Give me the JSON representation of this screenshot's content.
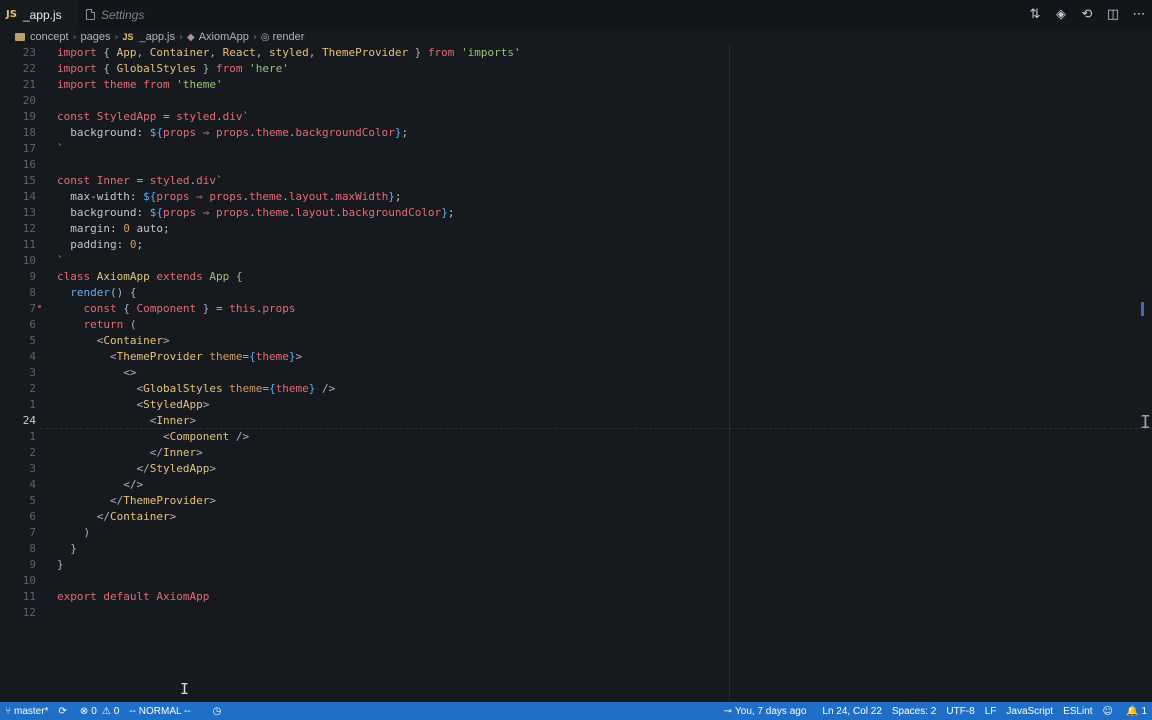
{
  "tabs": [
    {
      "label": "_app.js",
      "file_type": "JS",
      "active": true
    },
    {
      "label": "Settings",
      "active": false
    }
  ],
  "tab_actions": [
    "git-compare-icon",
    "go-to-file-icon",
    "preview-icon",
    "split-editor-icon",
    "more-actions-icon"
  ],
  "breadcrumb": {
    "items": [
      "concept",
      "pages",
      "_app.js",
      "AxiomApp",
      "render"
    ],
    "file_type": "JS"
  },
  "editor": {
    "cursor_line_index": 23,
    "lines": [
      {
        "ln": "23",
        "tokens": [
          [
            "kw",
            "import "
          ],
          [
            "punc",
            "{ "
          ],
          [
            "ty",
            "App"
          ],
          [
            "punc",
            ", "
          ],
          [
            "ty",
            "Container"
          ],
          [
            "punc",
            ", "
          ],
          [
            "ty",
            "React"
          ],
          [
            "punc",
            ", "
          ],
          [
            "ty",
            "styled"
          ],
          [
            "punc",
            ", "
          ],
          [
            "ty",
            "ThemeProvider"
          ],
          [
            "punc",
            " } "
          ],
          [
            "kw",
            "from "
          ],
          [
            "str",
            "'imports'"
          ]
        ]
      },
      {
        "ln": "22",
        "tokens": [
          [
            "kw",
            "import "
          ],
          [
            "punc",
            "{ "
          ],
          [
            "ty",
            "GlobalStyles"
          ],
          [
            "punc",
            " } "
          ],
          [
            "kw",
            "from "
          ],
          [
            "str",
            "'here'"
          ]
        ]
      },
      {
        "ln": "21",
        "tokens": [
          [
            "kw",
            "import "
          ],
          [
            "var",
            "theme "
          ],
          [
            "kw",
            "from "
          ],
          [
            "str",
            "'theme'"
          ]
        ]
      },
      {
        "ln": "20",
        "tokens": []
      },
      {
        "ln": "19",
        "tokens": [
          [
            "kw",
            "const "
          ],
          [
            "var",
            "StyledApp "
          ],
          [
            "punc",
            "= "
          ],
          [
            "var",
            "styled"
          ],
          [
            "punc",
            "."
          ],
          [
            "var",
            "div"
          ],
          [
            "str",
            "`"
          ]
        ]
      },
      {
        "ln": "18",
        "tokens": [
          [
            "txt",
            "  background: "
          ],
          [
            "fn",
            "${"
          ],
          [
            "var",
            "props "
          ],
          [
            "kw",
            "⇒ "
          ],
          [
            "var",
            "props"
          ],
          [
            "punc",
            "."
          ],
          [
            "var",
            "theme"
          ],
          [
            "punc",
            "."
          ],
          [
            "var",
            "backgroundColor"
          ],
          [
            "fn",
            "}"
          ],
          [
            "txt",
            ";"
          ]
        ]
      },
      {
        "ln": "17",
        "tokens": [
          [
            "str",
            "`"
          ]
        ]
      },
      {
        "ln": "16",
        "tokens": []
      },
      {
        "ln": "15",
        "tokens": [
          [
            "kw",
            "const "
          ],
          [
            "var",
            "Inner "
          ],
          [
            "punc",
            "= "
          ],
          [
            "var",
            "styled"
          ],
          [
            "punc",
            "."
          ],
          [
            "var",
            "div"
          ],
          [
            "str",
            "`"
          ]
        ]
      },
      {
        "ln": "14",
        "tokens": [
          [
            "txt",
            "  max-width: "
          ],
          [
            "fn",
            "${"
          ],
          [
            "var",
            "props "
          ],
          [
            "kw",
            "⇒ "
          ],
          [
            "var",
            "props"
          ],
          [
            "punc",
            "."
          ],
          [
            "var",
            "theme"
          ],
          [
            "punc",
            "."
          ],
          [
            "var",
            "layout"
          ],
          [
            "punc",
            "."
          ],
          [
            "var",
            "maxWidth"
          ],
          [
            "fn",
            "}"
          ],
          [
            "txt",
            ";"
          ]
        ]
      },
      {
        "ln": "13",
        "tokens": [
          [
            "txt",
            "  background: "
          ],
          [
            "fn",
            "${"
          ],
          [
            "var",
            "props "
          ],
          [
            "kw",
            "⇒ "
          ],
          [
            "var",
            "props"
          ],
          [
            "punc",
            "."
          ],
          [
            "var",
            "theme"
          ],
          [
            "punc",
            "."
          ],
          [
            "var",
            "layout"
          ],
          [
            "punc",
            "."
          ],
          [
            "var",
            "backgroundColor"
          ],
          [
            "fn",
            "}"
          ],
          [
            "txt",
            ";"
          ]
        ]
      },
      {
        "ln": "12",
        "tokens": [
          [
            "txt",
            "  margin: "
          ],
          [
            "num",
            "0"
          ],
          [
            "txt",
            " auto;"
          ]
        ]
      },
      {
        "ln": "11",
        "tokens": [
          [
            "txt",
            "  padding: "
          ],
          [
            "num",
            "0"
          ],
          [
            "txt",
            ";"
          ]
        ]
      },
      {
        "ln": "10",
        "tokens": [
          [
            "str",
            "`"
          ]
        ]
      },
      {
        "ln": "9",
        "tokens": [
          [
            "kw",
            "class "
          ],
          [
            "ty",
            "AxiomApp "
          ],
          [
            "kw",
            "extends "
          ],
          [
            "str",
            "App "
          ],
          [
            "punc",
            "{"
          ]
        ]
      },
      {
        "ln": "8",
        "tokens": [
          [
            "txt",
            "  "
          ],
          [
            "fn",
            "render"
          ],
          [
            "punc",
            "() {"
          ]
        ]
      },
      {
        "ln": "7",
        "tokens": [
          [
            "txt",
            "    "
          ],
          [
            "kw",
            "const "
          ],
          [
            "punc",
            "{ "
          ],
          [
            "var",
            "Component "
          ],
          [
            "punc",
            "} = "
          ],
          [
            "kw",
            "this"
          ],
          [
            "punc",
            "."
          ],
          [
            "var",
            "props"
          ]
        ]
      },
      {
        "ln": "6",
        "tokens": [
          [
            "txt",
            "    "
          ],
          [
            "kw",
            "return "
          ],
          [
            "punc",
            "("
          ]
        ]
      },
      {
        "ln": "5",
        "tokens": [
          [
            "txt",
            "      "
          ],
          [
            "punc",
            "<"
          ],
          [
            "tag",
            "Container"
          ],
          [
            "punc",
            ">"
          ]
        ]
      },
      {
        "ln": "4",
        "tokens": [
          [
            "txt",
            "        "
          ],
          [
            "punc",
            "<"
          ],
          [
            "tag",
            "ThemeProvider "
          ],
          [
            "attr",
            "theme"
          ],
          [
            "punc",
            "="
          ],
          [
            "fn",
            "{"
          ],
          [
            "var",
            "theme"
          ],
          [
            "fn",
            "}"
          ],
          [
            "punc",
            ">"
          ]
        ]
      },
      {
        "ln": "3",
        "tokens": [
          [
            "txt",
            "          "
          ],
          [
            "punc",
            "<>"
          ]
        ]
      },
      {
        "ln": "2",
        "tokens": [
          [
            "txt",
            "            "
          ],
          [
            "punc",
            "<"
          ],
          [
            "tag",
            "GlobalStyles "
          ],
          [
            "attr",
            "theme"
          ],
          [
            "punc",
            "="
          ],
          [
            "fn",
            "{"
          ],
          [
            "var",
            "theme"
          ],
          [
            "fn",
            "}"
          ],
          [
            "punc",
            " />"
          ]
        ]
      },
      {
        "ln": "1",
        "tokens": [
          [
            "txt",
            "            "
          ],
          [
            "punc",
            "<"
          ],
          [
            "tag",
            "StyledApp"
          ],
          [
            "punc",
            ">"
          ]
        ]
      },
      {
        "ln": "24",
        "tokens": [
          [
            "txt",
            "              "
          ],
          [
            "punc",
            "<"
          ],
          [
            "tag",
            "Inner"
          ],
          [
            "punc",
            ">"
          ]
        ]
      },
      {
        "ln": "1",
        "tokens": [
          [
            "txt",
            "                "
          ],
          [
            "punc",
            "<"
          ],
          [
            "tag",
            "Component "
          ],
          [
            "punc",
            "/>"
          ]
        ]
      },
      {
        "ln": "2",
        "tokens": [
          [
            "txt",
            "              "
          ],
          [
            "punc",
            "</"
          ],
          [
            "tag",
            "Inner"
          ],
          [
            "punc",
            ">"
          ]
        ]
      },
      {
        "ln": "3",
        "tokens": [
          [
            "txt",
            "            "
          ],
          [
            "punc",
            "</"
          ],
          [
            "tag",
            "StyledApp"
          ],
          [
            "punc",
            ">"
          ]
        ]
      },
      {
        "ln": "4",
        "tokens": [
          [
            "txt",
            "          "
          ],
          [
            "punc",
            "</>"
          ]
        ]
      },
      {
        "ln": "5",
        "tokens": [
          [
            "txt",
            "        "
          ],
          [
            "punc",
            "</"
          ],
          [
            "tag",
            "ThemeProvider"
          ],
          [
            "punc",
            ">"
          ]
        ]
      },
      {
        "ln": "6",
        "tokens": [
          [
            "txt",
            "      "
          ],
          [
            "punc",
            "</"
          ],
          [
            "tag",
            "Container"
          ],
          [
            "punc",
            ">"
          ]
        ]
      },
      {
        "ln": "7",
        "tokens": [
          [
            "txt",
            "    "
          ],
          [
            "punc",
            ")"
          ]
        ]
      },
      {
        "ln": "8",
        "tokens": [
          [
            "txt",
            "  "
          ],
          [
            "punc",
            "}"
          ]
        ]
      },
      {
        "ln": "9",
        "tokens": [
          [
            "punc",
            "}"
          ]
        ]
      },
      {
        "ln": "10",
        "tokens": []
      },
      {
        "ln": "11",
        "tokens": [
          [
            "kw",
            "export "
          ],
          [
            "kw",
            "default "
          ],
          [
            "var",
            "AxiomApp"
          ]
        ]
      },
      {
        "ln": "12",
        "tokens": []
      }
    ]
  },
  "statusbar": {
    "branch": "master*",
    "errors": "0",
    "warnings": "0",
    "vim_mode": "-- NORMAL --",
    "blame": "You, 7 days ago",
    "position": "Ln 24, Col 22",
    "spaces": "Spaces: 2",
    "encoding": "UTF-8",
    "eol": "LF",
    "language": "JavaScript",
    "linter": "ESLint",
    "notifications": "1"
  },
  "colors": {
    "background": "#16191e",
    "statusbar": "#1f6fc8",
    "keyword": "#e06c75",
    "type": "#e5c07b",
    "string": "#98c379",
    "function": "#61afef"
  }
}
